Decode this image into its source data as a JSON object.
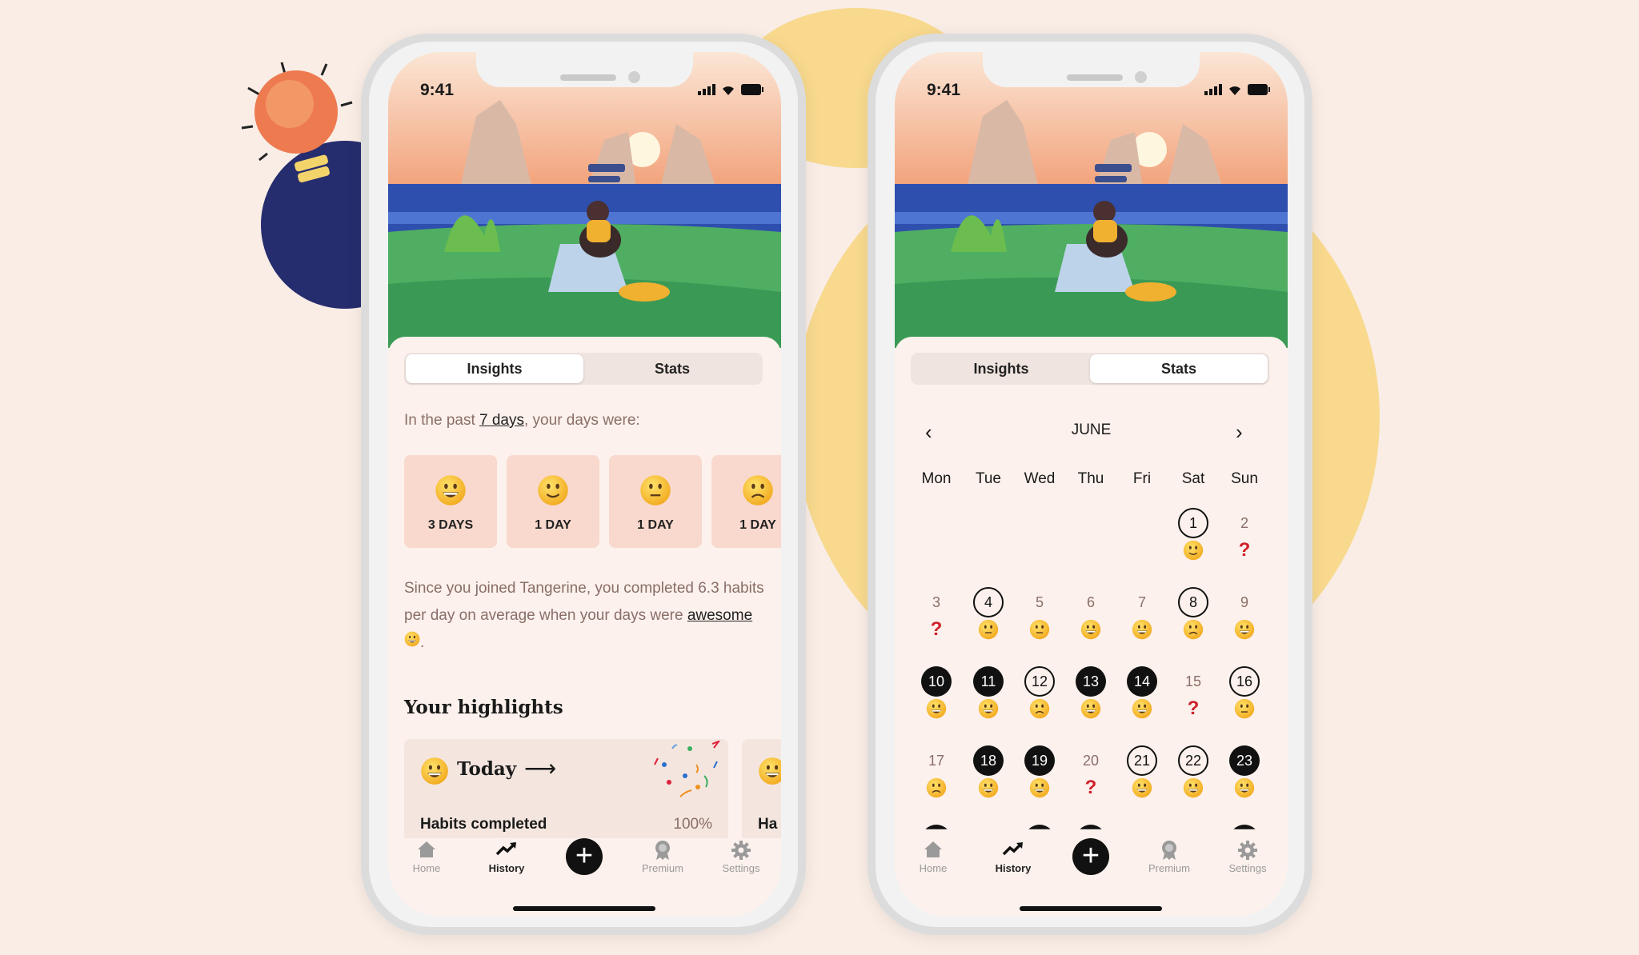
{
  "colors": {
    "background": "#f9ede6",
    "accent_yellow": "#f8d98e",
    "navy": "#262d6e",
    "unknown_mood": "#d0202a"
  },
  "status": {
    "time": "9:41"
  },
  "segments": {
    "insights": "Insights",
    "stats": "Stats"
  },
  "insights": {
    "intro_prefix": "In the past ",
    "intro_link": "7 days",
    "intro_suffix": ", your days were:",
    "mood_counts": [
      {
        "mood": "awesome",
        "label": "3 DAYS"
      },
      {
        "mood": "good",
        "label": "1 DAY"
      },
      {
        "mood": "meh",
        "label": "1 DAY"
      },
      {
        "mood": "bad",
        "label": "1 DAY"
      }
    ],
    "para_prefix": "Since you joined Tangerine, you completed 6.3 habits per day on average when your days were ",
    "para_link": "awesome",
    "para_suffix": ".",
    "highlights_title": "Your highlights",
    "highlight": {
      "title": "Today",
      "arrow": "⟶",
      "metric": "Habits completed",
      "value": "100%",
      "next_metric_partial": "Ha"
    }
  },
  "stats": {
    "month": "JUNE",
    "weekdays": [
      "Mon",
      "Tue",
      "Wed",
      "Thu",
      "Fri",
      "Sat",
      "Sun"
    ],
    "unknown_glyph": "?",
    "weeks": [
      [
        null,
        null,
        null,
        null,
        null,
        {
          "d": "1",
          "s": "outline",
          "m": "good"
        },
        {
          "d": "2",
          "s": "none",
          "m": "unknown"
        }
      ],
      [
        {
          "d": "3",
          "s": "none",
          "m": "unknown"
        },
        {
          "d": "4",
          "s": "outline",
          "m": "meh"
        },
        {
          "d": "5",
          "s": "none",
          "m": "meh"
        },
        {
          "d": "6",
          "s": "none",
          "m": "awesome"
        },
        {
          "d": "7",
          "s": "none",
          "m": "awesome"
        },
        {
          "d": "8",
          "s": "outline",
          "m": "bad"
        },
        {
          "d": "9",
          "s": "none",
          "m": "awesome"
        }
      ],
      [
        {
          "d": "10",
          "s": "filled",
          "m": "awesome"
        },
        {
          "d": "11",
          "s": "filled",
          "m": "awesome"
        },
        {
          "d": "12",
          "s": "outline",
          "m": "bad"
        },
        {
          "d": "13",
          "s": "filled",
          "m": "awesome"
        },
        {
          "d": "14",
          "s": "filled",
          "m": "awesome"
        },
        {
          "d": "15",
          "s": "none",
          "m": "unknown"
        },
        {
          "d": "16",
          "s": "outline",
          "m": "meh"
        }
      ],
      [
        {
          "d": "17",
          "s": "none",
          "m": "bad"
        },
        {
          "d": "18",
          "s": "filled",
          "m": "awesome"
        },
        {
          "d": "19",
          "s": "filled",
          "m": "awesome"
        },
        {
          "d": "20",
          "s": "none",
          "m": "unknown"
        },
        {
          "d": "21",
          "s": "outline",
          "m": "awesome"
        },
        {
          "d": "22",
          "s": "outline",
          "m": "awesome"
        },
        {
          "d": "23",
          "s": "filled",
          "m": "awesome"
        }
      ]
    ]
  },
  "tabbar": [
    {
      "label": "Home",
      "icon": "home-icon"
    },
    {
      "label": "History",
      "icon": "trend-icon",
      "active": true
    },
    {
      "label": "",
      "icon": "plus-icon"
    },
    {
      "label": "Premium",
      "icon": "award-icon"
    },
    {
      "label": "Settings",
      "icon": "gear-icon"
    }
  ]
}
